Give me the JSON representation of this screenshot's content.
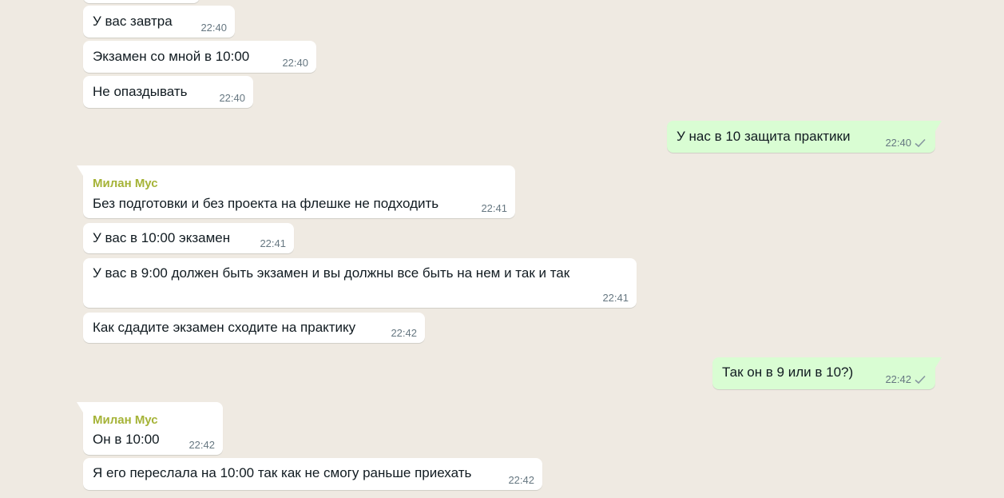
{
  "messages": [
    {
      "text": "У вас завтра",
      "time": "22:40"
    },
    {
      "text": "Экзамен со мной в 10:00",
      "time": "22:40"
    },
    {
      "text": "Не опаздывать",
      "time": "22:40"
    },
    {
      "text": "У нас в 10 защита практики",
      "time": "22:40"
    },
    {
      "sender": "Милан Мус",
      "text": "Без подготовки и без проекта на флешке не подходить",
      "time": "22:41"
    },
    {
      "text": "У вас в 10:00 экзамен",
      "time": "22:41"
    },
    {
      "text": "У вас в 9:00 должен быть экзамен и вы должны все быть на нем и так и так",
      "time": "22:41"
    },
    {
      "text": "Как сдадите экзамен сходите на практику",
      "time": "22:42"
    },
    {
      "text": "Так он в 9 или в 10?)",
      "time": "22:42"
    },
    {
      "sender": "Милан Мус",
      "text": "Он в 10:00",
      "time": "22:42"
    },
    {
      "text": "Я его переслала на 10:00 так как не смогу раньше приехать",
      "time": "22:42"
    }
  ],
  "colors": {
    "background": "#efeae2",
    "incoming_bubble": "#ffffff",
    "outgoing_bubble": "#d9fdd3",
    "sender_name": "#a5b337",
    "timestamp": "#667781",
    "check": "#8696a0"
  }
}
